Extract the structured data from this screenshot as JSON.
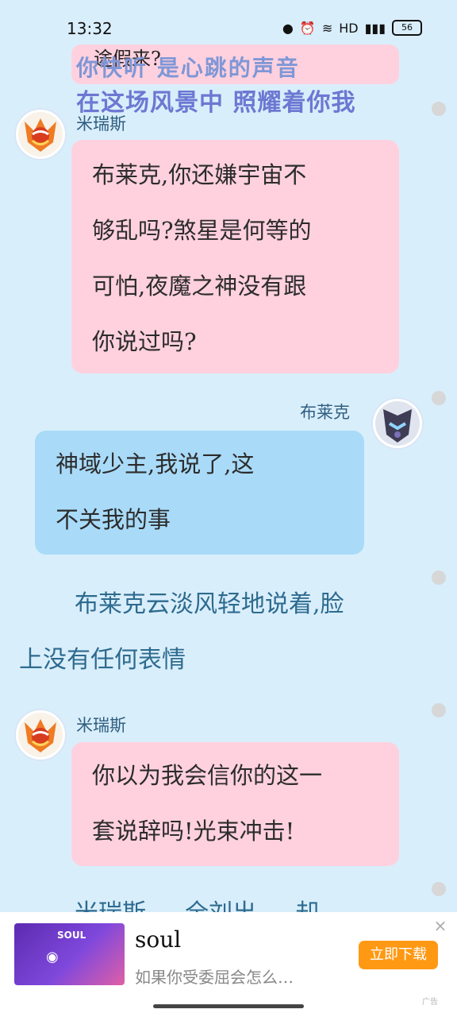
{
  "status": {
    "time": "13:32",
    "battery": "56",
    "icons": [
      "water-drop-icon",
      "alarm-icon",
      "wifi-icon",
      "hd-icon",
      "signal-icon"
    ]
  },
  "chat": {
    "top_fragment": "途假来?",
    "lyrics": [
      "你快听 是心跳的声音",
      "在这场风景中 照耀着你我"
    ],
    "messages": [
      {
        "speaker": "米瑞斯",
        "lines": [
          "布莱克,你还嫌宇宙不",
          "够乱吗?煞星是何等的",
          "可怕,夜魔之神没有跟",
          "你说过吗?"
        ]
      },
      {
        "speaker": "布莱克",
        "lines": [
          "神域少主,我说了,这",
          "不关我的事"
        ]
      },
      {
        "speaker": "米瑞斯",
        "lines": [
          "你以为我会信你的这一",
          "套说辞吗!光束冲击!"
        ]
      }
    ],
    "narration": [
      "布莱克云淡风轻地说着,脸",
      "上没有任何表情"
    ],
    "cut_text": "米瑞斯 … 全刘出 … 却"
  },
  "ad": {
    "title": "soul",
    "description": "如果你受委屈会怎么…",
    "button": "立即下载",
    "badge": "广告"
  },
  "colors": {
    "background": "#d9eefb",
    "pink_bubble": "#ffd1df",
    "blue_bubble": "#a9dbf9",
    "narration": "#2d6b8f",
    "ad_button": "#ff9914"
  }
}
